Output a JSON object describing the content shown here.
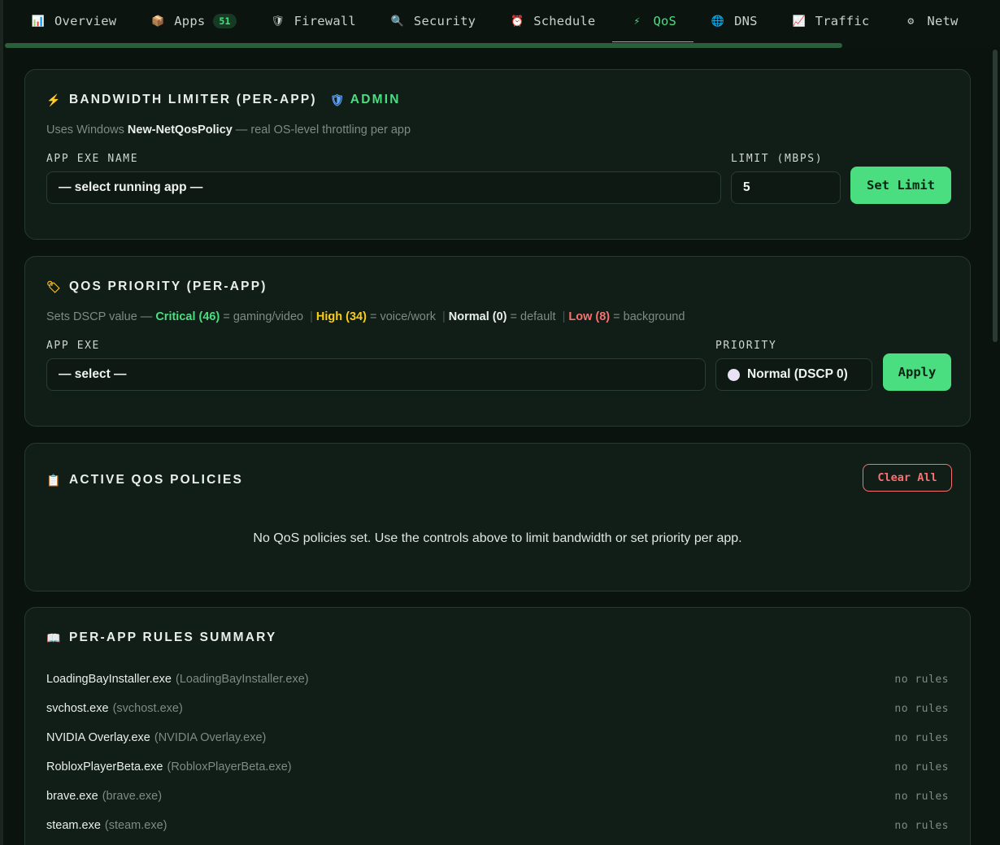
{
  "tabs": [
    {
      "icon": "📊",
      "icon_name": "bar-chart-icon",
      "label": "Overview"
    },
    {
      "icon": "📦",
      "icon_name": "package-icon",
      "label": "Apps",
      "badge": "51"
    },
    {
      "icon": "🛡",
      "icon_name": "shield-icon",
      "label": "Firewall"
    },
    {
      "icon": "🔍",
      "icon_name": "magnifier-icon",
      "label": "Security"
    },
    {
      "icon": "⏰",
      "icon_name": "alarm-clock-icon",
      "label": "Schedule"
    },
    {
      "icon": "⚡",
      "icon_name": "lightning-icon",
      "label": "QoS",
      "active": true
    },
    {
      "icon": "🌐",
      "icon_name": "globe-icon",
      "label": "DNS"
    },
    {
      "icon": "📈",
      "icon_name": "trend-chart-icon",
      "label": "Traffic"
    },
    {
      "icon": "⚙",
      "icon_name": "gear-icon",
      "label": "Netw"
    }
  ],
  "bandwidth": {
    "title": "Bandwidth Limiter (Per-App)",
    "admin_label": "Admin",
    "desc_pre": "Uses Windows ",
    "desc_bold": "New-NetQosPolicy",
    "desc_post": " — real OS-level throttling per app",
    "app_label": "App Exe Name",
    "app_value": "— select running app —",
    "limit_label": "Limit (Mbps)",
    "limit_value": "5",
    "button": "Set Limit"
  },
  "priority": {
    "title": "QoS Priority (Per-App)",
    "desc_pre": "Sets DSCP value — ",
    "critical": "Critical (46)",
    "critical_desc": " = gaming/video ",
    "high": "High (34)",
    "high_desc": " = voice/work ",
    "normal": "Normal (0)",
    "normal_desc": " = default ",
    "low": "Low (8)",
    "low_desc": " = background",
    "app_label": "App Exe",
    "app_value": "— select —",
    "priority_label": "Priority",
    "priority_value": "Normal (DSCP 0)",
    "button": "Apply"
  },
  "active": {
    "title": "Active QoS Policies",
    "clear_button": "Clear All",
    "empty_message": "No QoS policies set. Use the controls above to limit bandwidth or set priority per app."
  },
  "summary": {
    "title": "Per-App Rules Summary",
    "rows": [
      {
        "name": "LoadingBayInstaller.exe",
        "exe": "(LoadingBayInstaller.exe)",
        "status": "no rules"
      },
      {
        "name": "svchost.exe",
        "exe": "(svchost.exe)",
        "status": "no rules"
      },
      {
        "name": "NVIDIA Overlay.exe",
        "exe": "(NVIDIA Overlay.exe)",
        "status": "no rules"
      },
      {
        "name": "RobloxPlayerBeta.exe",
        "exe": "(RobloxPlayerBeta.exe)",
        "status": "no rules"
      },
      {
        "name": "brave.exe",
        "exe": "(brave.exe)",
        "status": "no rules"
      },
      {
        "name": "steam.exe",
        "exe": "(steam.exe)",
        "status": "no rules"
      }
    ]
  },
  "colors": {
    "accent": "#4ade80",
    "danger": "#f87171",
    "high": "#facc15",
    "background": "#0b130f",
    "card": "#111d17"
  }
}
